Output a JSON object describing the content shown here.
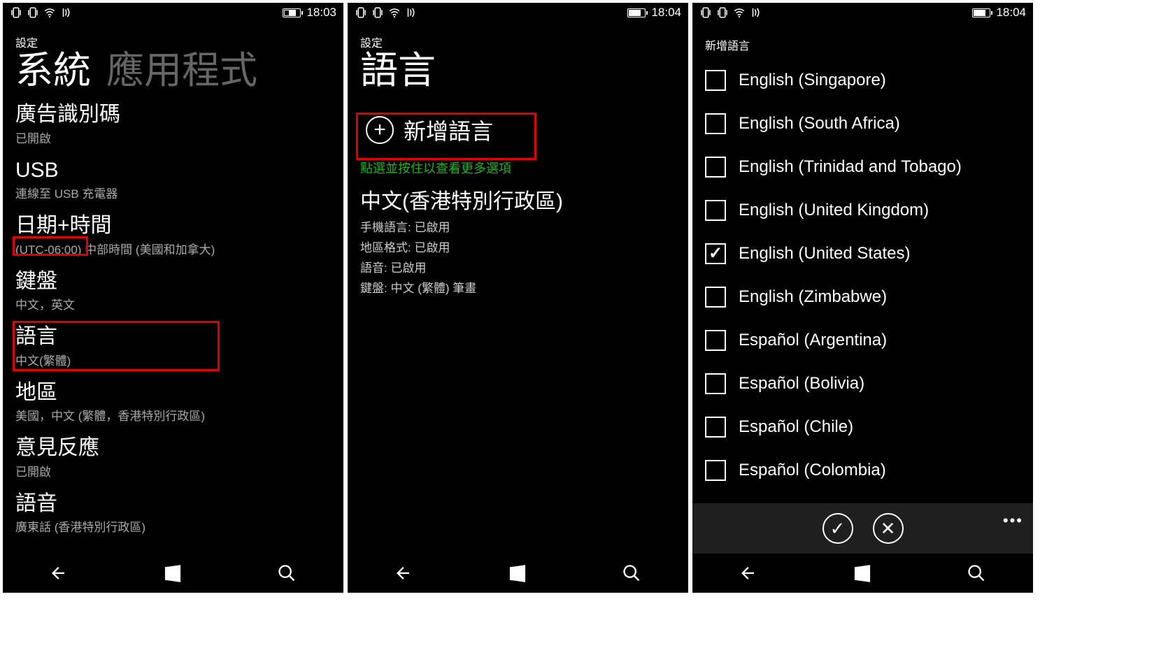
{
  "screen1": {
    "status": {
      "time": "18:03",
      "charging": true
    },
    "breadcrumb": "設定",
    "tabs": {
      "active": "系統",
      "inactive": "應用程式"
    },
    "items": [
      {
        "title": "廣告識別碼",
        "sub": "已開啟"
      },
      {
        "title": "USB",
        "sub": "連線至 USB 充電器"
      },
      {
        "title": "日期+時間",
        "sub": "(UTC-06:00) 中部時間 (美國和加拿大)",
        "hl_sub_partial": true
      },
      {
        "title": "鍵盤",
        "sub": "中文，英文"
      },
      {
        "title": "語言",
        "sub": "中文(繁體)",
        "highlight": true
      },
      {
        "title": "地區",
        "sub": "美國，中文 (繁體，香港特別行政區)"
      },
      {
        "title": "意見反應",
        "sub": "已開啟"
      },
      {
        "title": "語音",
        "sub": "廣東話 (香港特別行政區)"
      }
    ]
  },
  "screen2": {
    "status": {
      "time": "18:04",
      "charging": false
    },
    "breadcrumb": "設定",
    "title": "語言",
    "add_label": "新增語言",
    "hint": "點選並按住以查看更多選項",
    "lang": {
      "name": "中文(香港特別行政區)",
      "rows": [
        {
          "k": "手機語言:",
          "v": "已啟用"
        },
        {
          "k": "地區格式:",
          "v": "已啟用"
        },
        {
          "k": "語音:",
          "v": "已啟用"
        },
        {
          "k": "鍵盤:",
          "v": "中文 (繁體) 筆畫"
        }
      ]
    }
  },
  "screen3": {
    "status": {
      "time": "18:04",
      "charging": false
    },
    "title": "新增語言",
    "languages": [
      {
        "label": "English (Singapore)",
        "checked": false
      },
      {
        "label": "English (South Africa)",
        "checked": false
      },
      {
        "label": "English (Trinidad and Tobago)",
        "checked": false
      },
      {
        "label": "English (United Kingdom)",
        "checked": false
      },
      {
        "label": "English (United States)",
        "checked": true
      },
      {
        "label": "English (Zimbabwe)",
        "checked": false
      },
      {
        "label": "Español (Argentina)",
        "checked": false
      },
      {
        "label": "Español (Bolivia)",
        "checked": false
      },
      {
        "label": "Español (Chile)",
        "checked": false
      },
      {
        "label": "Español (Colombia)",
        "checked": false
      }
    ]
  },
  "icons": {
    "vibrate": "vibrate-icon",
    "wifi": "wifi-icon",
    "extra": "nfc-icon"
  }
}
